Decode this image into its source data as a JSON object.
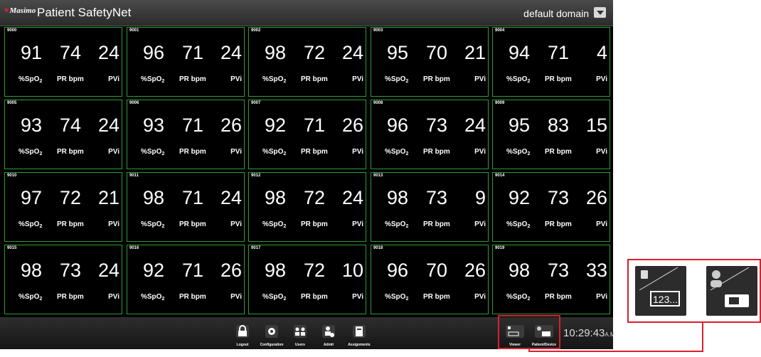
{
  "header": {
    "logo_text": "Masimo",
    "title": "Patient SafetyNet",
    "domain": "default domain"
  },
  "labels": {
    "spo2": "%SpO",
    "spo2_sub": "2",
    "pr": "PR bpm",
    "pvi": "PVi"
  },
  "tiles": [
    {
      "bed": "9000",
      "spo2": "91",
      "pr": "74",
      "pvi": "24"
    },
    {
      "bed": "9001",
      "spo2": "96",
      "pr": "71",
      "pvi": "24"
    },
    {
      "bed": "9002",
      "spo2": "98",
      "pr": "72",
      "pvi": "24"
    },
    {
      "bed": "9003",
      "spo2": "95",
      "pr": "70",
      "pvi": "21"
    },
    {
      "bed": "9004",
      "spo2": "94",
      "pr": "71",
      "pvi": "4"
    },
    {
      "bed": "9005",
      "spo2": "93",
      "pr": "74",
      "pvi": "24"
    },
    {
      "bed": "9006",
      "spo2": "93",
      "pr": "71",
      "pvi": "26"
    },
    {
      "bed": "9007",
      "spo2": "92",
      "pr": "71",
      "pvi": "26"
    },
    {
      "bed": "9008",
      "spo2": "96",
      "pr": "73",
      "pvi": "24"
    },
    {
      "bed": "9009",
      "spo2": "95",
      "pr": "83",
      "pvi": "15"
    },
    {
      "bed": "9010",
      "spo2": "97",
      "pr": "72",
      "pvi": "21"
    },
    {
      "bed": "9011",
      "spo2": "98",
      "pr": "71",
      "pvi": "24"
    },
    {
      "bed": "9012",
      "spo2": "98",
      "pr": "72",
      "pvi": "24"
    },
    {
      "bed": "9013",
      "spo2": "98",
      "pr": "73",
      "pvi": "9"
    },
    {
      "bed": "9014",
      "spo2": "92",
      "pr": "73",
      "pvi": "26"
    },
    {
      "bed": "9015",
      "spo2": "98",
      "pr": "73",
      "pvi": "24"
    },
    {
      "bed": "9016",
      "spo2": "92",
      "pr": "71",
      "pvi": "26"
    },
    {
      "bed": "9017",
      "spo2": "98",
      "pr": "72",
      "pvi": "10"
    },
    {
      "bed": "9018",
      "spo2": "96",
      "pr": "70",
      "pvi": "26"
    },
    {
      "bed": "9019",
      "spo2": "98",
      "pr": "73",
      "pvi": "33"
    }
  ],
  "toolbar": {
    "logout": "Logout",
    "configuration": "Configuration",
    "users": "Users",
    "admit": "Admit",
    "assignments": "Assignments",
    "viewer": "Viewer",
    "patient_device": "Patient/Device",
    "viewer_icon_text": "123..."
  },
  "clock": {
    "time": "10:29:43",
    "ampm": "A.M."
  },
  "colors": {
    "tile_border": "#2f9a3a",
    "highlight": "#d8202e",
    "background": "#000000"
  }
}
